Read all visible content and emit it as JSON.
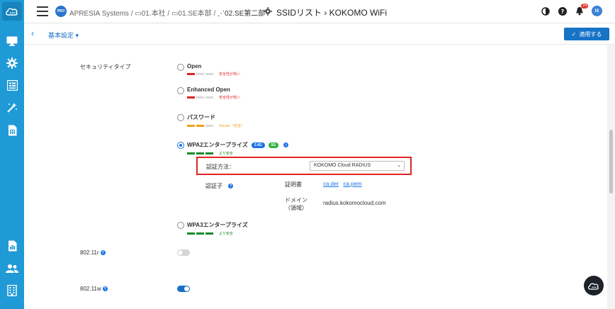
{
  "header": {
    "pro_badge": "PRO",
    "breadcrumb": {
      "org": "APRESIA Systems",
      "sep1": " / ",
      "site1": "01.本社",
      "sep2": " / ",
      "site2": "01.SE本部",
      "sep3": " / ",
      "group": "02.SE第二部"
    },
    "title": "SSIDリスト › KOKOMO WiFi",
    "notification_count": "24",
    "avatar_initials": "IS"
  },
  "subheader": {
    "section_dropdown": "基本設定 ▾",
    "apply_label": "適用する"
  },
  "security": {
    "label": "セキュリティタイプ",
    "options": [
      {
        "label": "Open",
        "strength_text": "安全性が低い",
        "checked": false
      },
      {
        "label": "Enhanced Open",
        "strength_text": "安全性が低い",
        "checked": false
      },
      {
        "label": "パスワード",
        "strength_text": "Secure（安全）",
        "checked": false
      },
      {
        "label": "WPA2エンタープライズ",
        "strength_text": "より安全",
        "checked": true,
        "tags": [
          "2.4G",
          "5G"
        ]
      },
      {
        "label": "WPA3エンタープライズ",
        "strength_text": "より安全",
        "checked": false
      }
    ],
    "auth_method_label": "認証方法：",
    "auth_method_value": "KOKOMO Cloud RADIUS",
    "authenticator_label": "認証子",
    "certificate_label": "証明書",
    "cert_links": [
      "ca.der",
      "ca.pem"
    ],
    "domain_label_line1": "ドメイン",
    "domain_label_line2": "（領域）",
    "domain_value": "radius.kokomocloud.com"
  },
  "fields": {
    "r_label": "802.11r",
    "r_enabled": false,
    "w_label": "802.11w",
    "w_enabled": true
  },
  "colors": {
    "sidebar": "#1f9ad6",
    "accent": "#1a73e8",
    "danger": "#e02424",
    "warning": "#f2a018",
    "success": "#168a2a"
  }
}
